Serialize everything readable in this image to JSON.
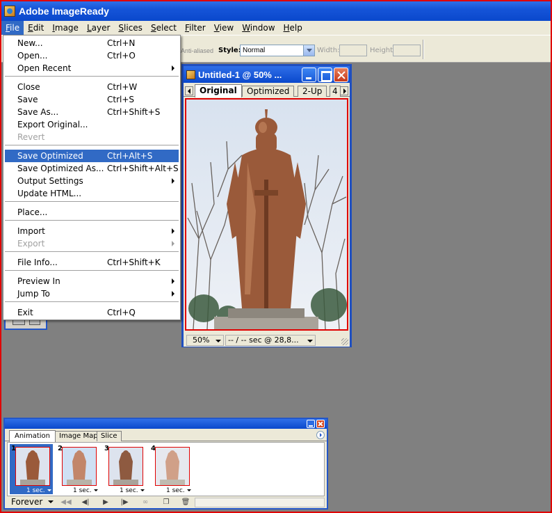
{
  "app": {
    "title": "Adobe ImageReady"
  },
  "menubar": [
    {
      "label": "File",
      "ul": "F",
      "rest": "ile"
    },
    {
      "label": "Edit",
      "ul": "E",
      "rest": "dit"
    },
    {
      "label": "Image",
      "ul": "I",
      "rest": "mage"
    },
    {
      "label": "Layer",
      "ul": "L",
      "rest": "ayer"
    },
    {
      "label": "Slices",
      "ul": "S",
      "rest": "lices"
    },
    {
      "label": "Select",
      "ul": "S",
      "rest": "elect"
    },
    {
      "label": "Filter",
      "ul": "F",
      "rest": "ilter"
    },
    {
      "label": "View",
      "ul": "V",
      "rest": "iew"
    },
    {
      "label": "Window",
      "ul": "W",
      "rest": "indow"
    },
    {
      "label": "Help",
      "ul": "H",
      "rest": "elp"
    }
  ],
  "options": {
    "antialias": "Anti-aliased",
    "style_label": "Style:",
    "style_value": "Normal",
    "width_label": "Width:",
    "height_label": "Height:"
  },
  "file_menu": {
    "items": [
      {
        "label": "New...",
        "shortcut": "Ctrl+N"
      },
      {
        "label": "Open...",
        "shortcut": "Ctrl+O"
      },
      {
        "label": "Open Recent",
        "shortcut": ""
      },
      {
        "label": "Close",
        "shortcut": "Ctrl+W"
      },
      {
        "label": "Save",
        "shortcut": "Ctrl+S"
      },
      {
        "label": "Save As...",
        "shortcut": "Ctrl+Shift+S"
      },
      {
        "label": "Export Original...",
        "shortcut": ""
      },
      {
        "label": "Revert",
        "shortcut": ""
      },
      {
        "label": "Save Optimized",
        "shortcut": "Ctrl+Alt+S"
      },
      {
        "label": "Save Optimized As...",
        "shortcut": "Ctrl+Shift+Alt+S"
      },
      {
        "label": "Output Settings",
        "shortcut": ""
      },
      {
        "label": "Update HTML...",
        "shortcut": ""
      },
      {
        "label": "Place...",
        "shortcut": ""
      },
      {
        "label": "Import",
        "shortcut": ""
      },
      {
        "label": "Export",
        "shortcut": ""
      },
      {
        "label": "File Info...",
        "shortcut": "Ctrl+Shift+K"
      },
      {
        "label": "Preview In",
        "shortcut": ""
      },
      {
        "label": "Jump To",
        "shortcut": ""
      },
      {
        "label": "Exit",
        "shortcut": "Ctrl+Q"
      }
    ]
  },
  "document": {
    "title": "Untitled-1 @ 50% ...",
    "tabs": [
      "Original",
      "Optimized",
      "2-Up",
      "4"
    ],
    "zoom": "50%",
    "status": "-- / -- sec @ 28,8..."
  },
  "animation_palette": {
    "tabs": [
      "Animation",
      "Image Map",
      "Slice"
    ],
    "frames": [
      {
        "number": "1",
        "delay": "1 sec."
      },
      {
        "number": "2",
        "delay": "1 sec."
      },
      {
        "number": "3",
        "delay": "1 sec."
      },
      {
        "number": "4",
        "delay": "1 sec."
      }
    ],
    "loop": "Forever"
  },
  "colors": {
    "accent": "#316ac5",
    "titlebar": "#0a48cc",
    "frame_border": "#e00000"
  }
}
